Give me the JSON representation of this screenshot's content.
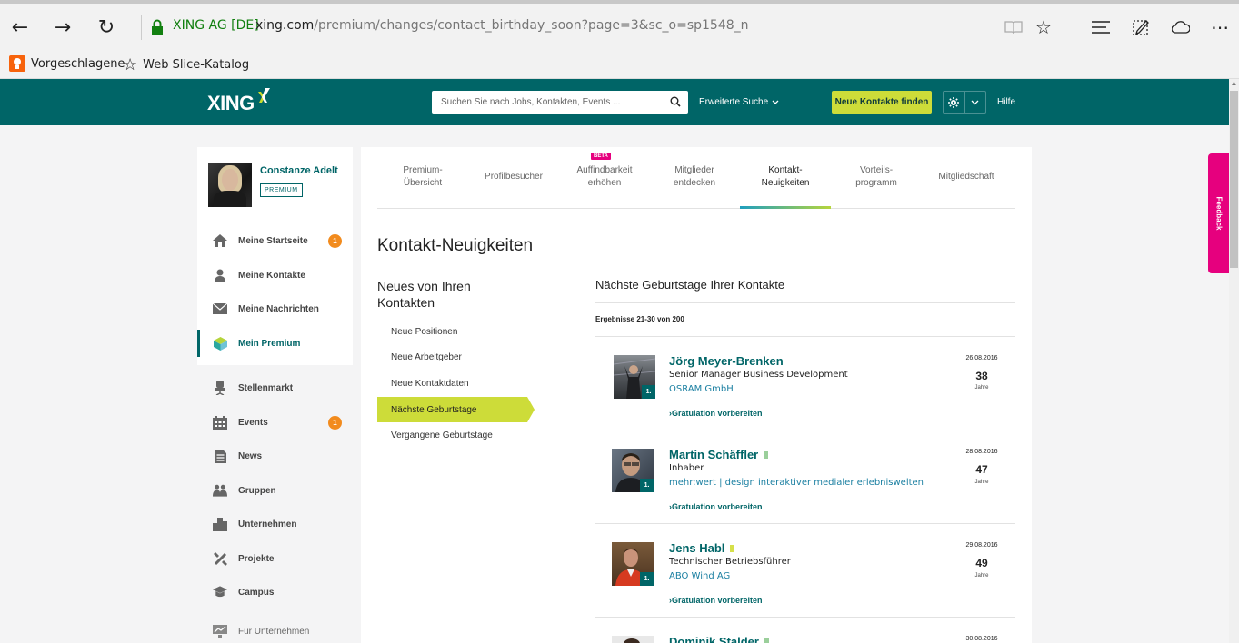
{
  "browser": {
    "site_identity": "XING AG [DE]",
    "url_host": "xing.com",
    "url_path": "/premium/changes/contact_birthday_soon?page=3&sc_o=sp1548_n",
    "favorites": [
      {
        "label": "Vorgeschlagene",
        "icon": "lightbulb-icon"
      },
      {
        "label": "Web Slice-Katalog",
        "icon": "star-outline-icon"
      }
    ]
  },
  "header": {
    "logo": "XING",
    "search_placeholder": "Suchen Sie nach Jobs, Kontakten, Events ...",
    "advanced_search": "Erweiterte Suche",
    "find_contacts": "Neue Kontakte finden",
    "help": "Hilfe"
  },
  "feedback": "Feedback",
  "profile": {
    "name": "Constanze Adelt",
    "badge": "PREMIUM"
  },
  "sidebar": {
    "items": [
      {
        "label": "Meine Startseite",
        "count": "1"
      },
      {
        "label": "Meine Kontakte"
      },
      {
        "label": "Meine Nachrichten"
      },
      {
        "label": "Mein Premium"
      },
      {
        "label": "Stellenmarkt"
      },
      {
        "label": "Events",
        "count": "1"
      },
      {
        "label": "News"
      },
      {
        "label": "Gruppen"
      },
      {
        "label": "Unternehmen"
      },
      {
        "label": "Projekte"
      },
      {
        "label": "Campus"
      },
      {
        "label": "Für Unternehmen"
      }
    ]
  },
  "tabs": {
    "beta": "BETA",
    "items": [
      {
        "line1": "Premium-",
        "line2": "Übersicht"
      },
      {
        "line1": "Profilbesucher",
        "line2": ""
      },
      {
        "line1": "Auffindbarkeit",
        "line2": "erhöhen"
      },
      {
        "line1": "Mitglieder",
        "line2": "entdecken"
      },
      {
        "line1": "Kontakt-",
        "line2": "Neuigkeiten"
      },
      {
        "line1": "Vorteils-",
        "line2": "programm"
      },
      {
        "line1": "Mitgliedschaft",
        "line2": ""
      }
    ]
  },
  "page_title": "Kontakt-Neuigkeiten",
  "subnav": {
    "title": "Neues von Ihren Kontakten",
    "items": [
      "Neue Positionen",
      "Neue Arbeitgeber",
      "Neue Kontaktdaten",
      "Nächste Geburtstage",
      "Vergangene Geburtstage"
    ]
  },
  "list": {
    "title": "Nächste Geburtstage Ihrer Kontakte",
    "results": "Ergebnisse 21-30 von 200",
    "action_label": "Gratulation vorbereiten",
    "years_label": "Jahre",
    "entries": [
      {
        "name": "Jörg Meyer-Brenken",
        "role": "Senior Manager Business Development",
        "company": "OSRAM GmbH",
        "date": "26.08.2016",
        "age": "38",
        "degree": "1.",
        "status_color": ""
      },
      {
        "name": "Martin Schäffler",
        "role": "Inhaber",
        "company": "mehr:wert | design interaktiver medialer erlebniswelten",
        "date": "28.08.2016",
        "age": "47",
        "degree": "1.",
        "status_color": "#9bcf9b"
      },
      {
        "name": "Jens Habl",
        "role": "Technischer Betriebsführer",
        "company": "ABO Wind AG",
        "date": "29.08.2016",
        "age": "49",
        "degree": "1.",
        "status_color": "#d6e04a"
      },
      {
        "name": "Dominik Stalder",
        "role": "",
        "company": "",
        "date": "30.08.2016",
        "age": "",
        "degree": "",
        "status_color": "#9bcf9b"
      }
    ]
  },
  "colors": {
    "brand_teal": "#006567",
    "accent_lime": "#cddc39",
    "badge_orange": "#f28b1d",
    "feedback_pink": "#e6007e"
  }
}
